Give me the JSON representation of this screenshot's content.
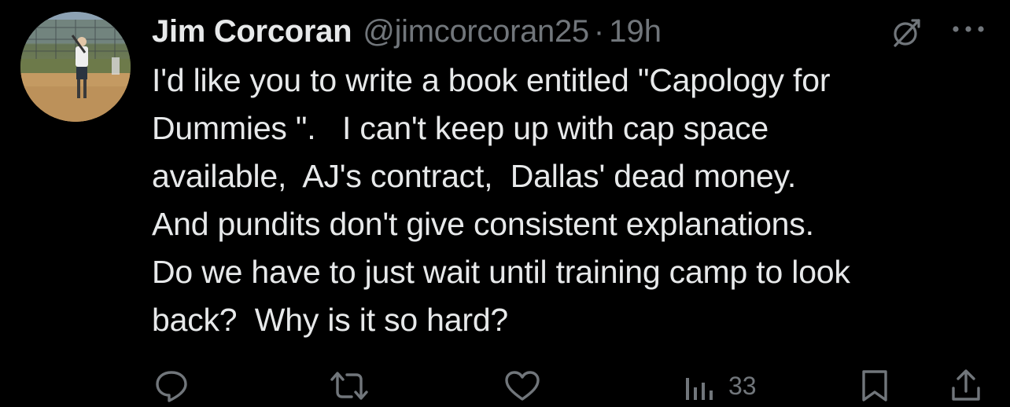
{
  "tweet": {
    "author": {
      "display_name": "Jim Corcoran",
      "handle": "@jimcorcoran25",
      "avatar": "baseball-batter-photo"
    },
    "separator": "·",
    "timestamp": "19h",
    "text": "I'd like you to write a book entitled \"Capology for\nDummies \".   I can't keep up with cap space\navailable,  AJ's contract,  Dallas' dead money.\nAnd pundits don't give consistent explanations.\nDo we have to just wait until training camp to look\nback?  Why is it so hard?",
    "header_icons": [
      "grok-icon",
      "more-options-icon"
    ],
    "actions": {
      "reply": {
        "icon": "reply-icon"
      },
      "repost": {
        "icon": "repost-icon"
      },
      "like": {
        "icon": "heart-icon"
      },
      "views": {
        "icon": "views-chart-icon",
        "count": "33"
      },
      "bookmark": {
        "icon": "bookmark-icon"
      },
      "share": {
        "icon": "share-icon"
      }
    }
  },
  "colors": {
    "background": "#000000",
    "text_primary": "#e7e9ea",
    "text_secondary": "#71767b"
  }
}
